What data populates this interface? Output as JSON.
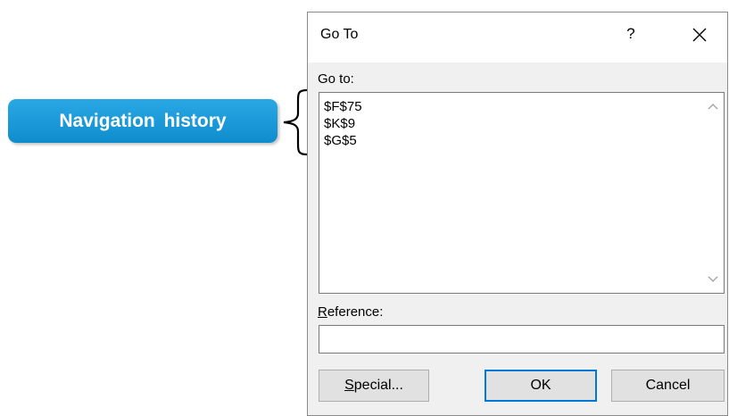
{
  "callout": {
    "text": "Navigation history",
    "color": "#1a9ad9"
  },
  "dialog": {
    "title": "Go To",
    "help_icon": "?",
    "close_icon": "close-icon",
    "goto_label": "Go to:",
    "history_items": [
      "$F$75",
      "$K$9",
      "$G$5"
    ],
    "reference_label_mnemonic": "R",
    "reference_label_rest": "eference:",
    "reference_value": "",
    "buttons": {
      "special_mnemonic": "S",
      "special_rest": "pecial...",
      "ok": "OK",
      "cancel": "Cancel"
    },
    "focus_color": "#0078d7"
  }
}
